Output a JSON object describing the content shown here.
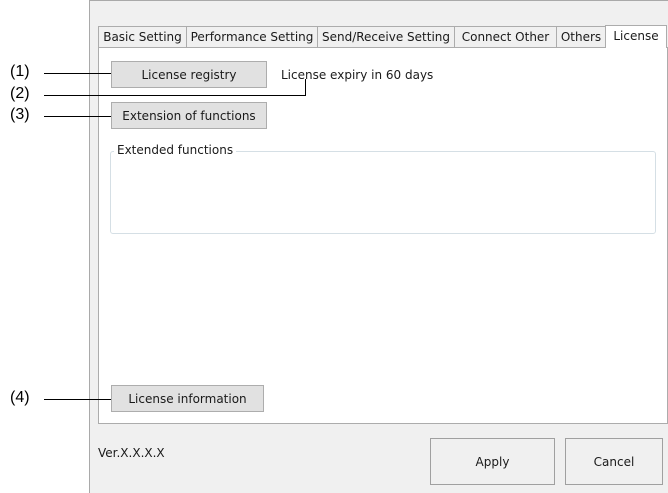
{
  "tabs": [
    {
      "label": "Basic Setting",
      "active": false
    },
    {
      "label": "Performance Setting",
      "active": false
    },
    {
      "label": "Send/Receive Setting",
      "active": false
    },
    {
      "label": "Connect Other",
      "active": false
    },
    {
      "label": "Others",
      "active": false
    },
    {
      "label": "License",
      "active": true
    }
  ],
  "license_panel": {
    "registry_button": "License registry",
    "expiry_text": "License expiry in 60 days",
    "extension_button": "Extension of functions",
    "extended_functions_title": "Extended functions",
    "information_button": "License information"
  },
  "footer": {
    "version": "Ver.X.X.X.X",
    "apply_button": "Apply",
    "cancel_button": "Cancel"
  },
  "callouts": [
    "(1)",
    "(2)",
    "(3)",
    "(4)"
  ]
}
